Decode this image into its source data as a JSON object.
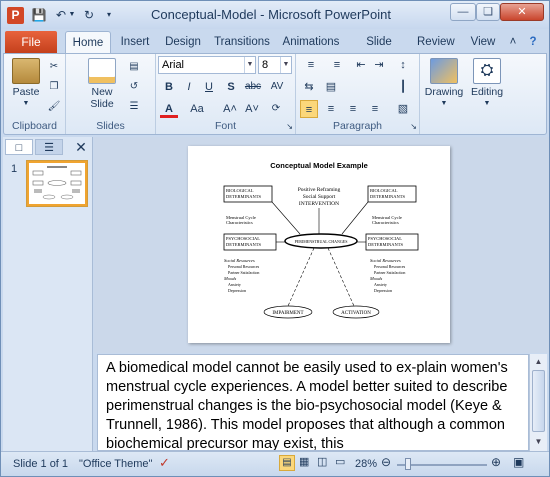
{
  "window": {
    "title": "Conceptual-Model  -  Microsoft PowerPoint",
    "app_icon": "P",
    "controls": [
      "minimize-icon",
      "restore-icon",
      "close-icon"
    ]
  },
  "qat": {
    "items": [
      "save-icon",
      "undo-icon",
      "redo-icon",
      "customize-icon"
    ]
  },
  "tabs": {
    "file": "File",
    "items": [
      "Home",
      "Insert",
      "Design",
      "Transitions",
      "Animations",
      "Slide Show",
      "Review",
      "View"
    ],
    "active": "Home"
  },
  "ribbon": {
    "clipboard": {
      "label": "Clipboard",
      "paste": "Paste"
    },
    "slides": {
      "label": "Slides",
      "new_slide_1": "New",
      "new_slide_2": "Slide"
    },
    "font": {
      "label": "Font",
      "family": "Arial",
      "size": "8",
      "bold": "B",
      "italic": "I",
      "underline": "U",
      "shadow": "S",
      "strike": "abc",
      "spacing": "AV",
      "font_color": "A",
      "change_case": "Aa",
      "grow": "A˄",
      "shrink": "A˅"
    },
    "paragraph": {
      "label": "Paragraph"
    },
    "drawing": {
      "label": "Drawing"
    },
    "editing": {
      "label": "Editing"
    }
  },
  "slides_pane": {
    "number": "1"
  },
  "slide": {
    "title": "Conceptual Model Example",
    "bio_left": [
      "BIOLOGICAL",
      "DETERMINANTS"
    ],
    "bio_right": [
      "BIOLOGICAL",
      "DETERMINANTS"
    ],
    "center_top": [
      "Positive Reframing",
      "Social Support",
      "INTERVENTION"
    ],
    "menstrual_left": [
      "Menstrual Cycle",
      "Characteristics"
    ],
    "menstrual_right": [
      "Menstrual Cycle",
      "Characteristics"
    ],
    "psych_left": [
      "PSYCHOSOCIAL",
      "DETERMINANTS"
    ],
    "psych_right": [
      "PSYCHOSOCIAL",
      "DETERMINANTS"
    ],
    "center_ellipse": "PERIMENSTRUAL CHANGES",
    "social_left": [
      "Social Resources",
      "Personal Resources",
      "Partner Satisfaction",
      "Moods",
      "Anxiety",
      "Depression"
    ],
    "social_right": [
      "Social Resources",
      "Personal Resources",
      "Partner Satisfaction",
      "Moods",
      "Anxiety",
      "Depression"
    ],
    "impairment": "IMPAIRMENT",
    "activation": "ACTIVATION"
  },
  "notes": {
    "text": "A biomedical model cannot be easily used to ex-plain women's menstrual cycle experiences. A model better suited to describe perimenstrual changes is the bio-psychosocial model (Keye & Trunnell, 1986). This model proposes that although a common biochemical precursor may exist, this"
  },
  "status": {
    "slide_info": "Slide 1 of 1",
    "theme": "\"Office Theme\"",
    "zoom": "28%"
  },
  "colors": {
    "ribbon_bg": "#dde8f5",
    "file_tab": "#d24726",
    "selection_orange": "#f0a430",
    "close_red": "#c9452d"
  }
}
